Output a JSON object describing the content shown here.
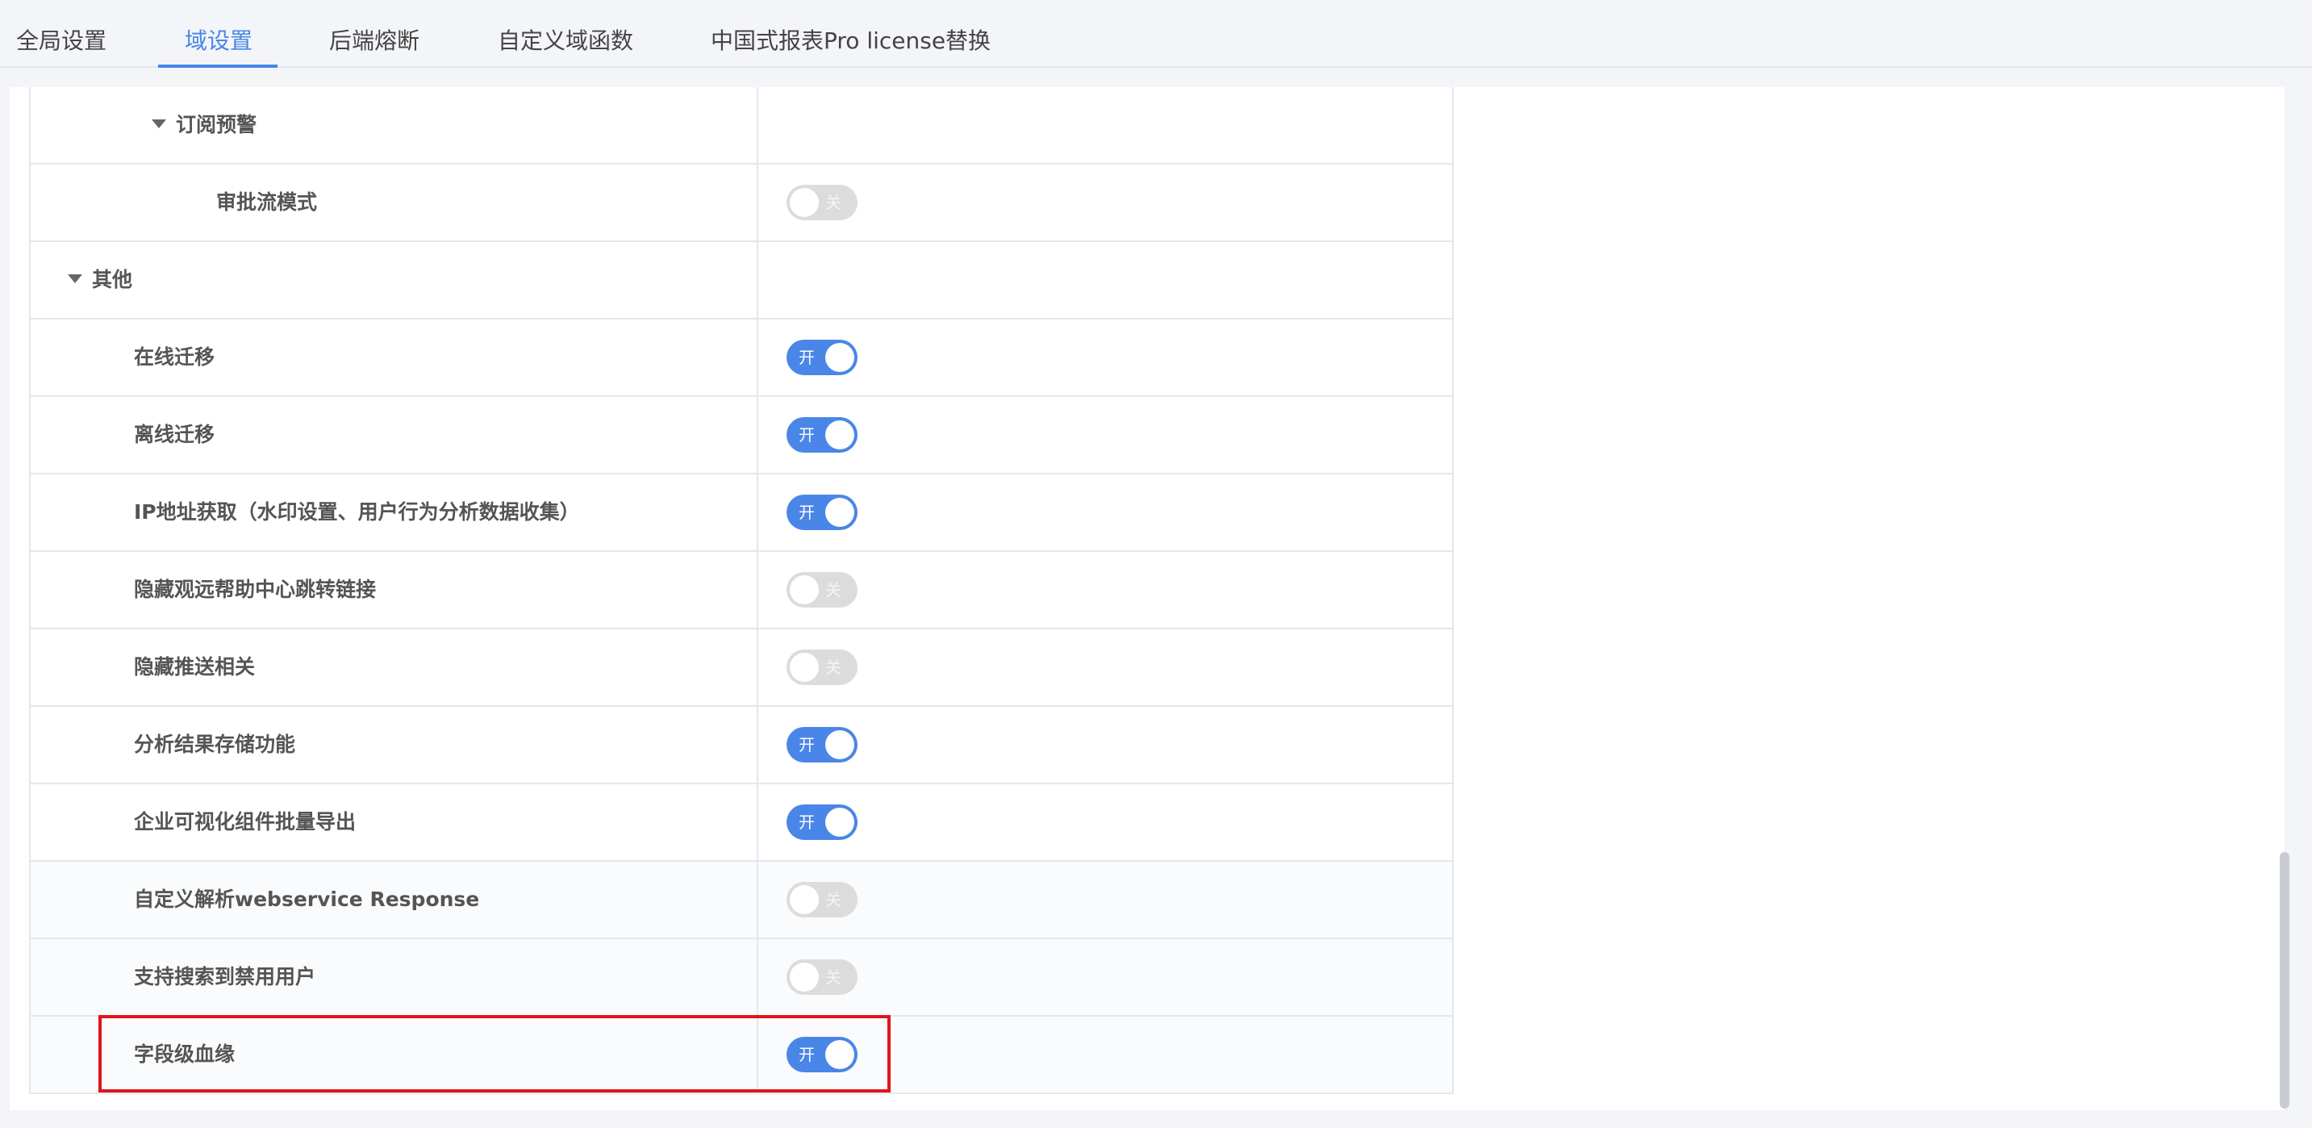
{
  "tabs": [
    {
      "label": "全局设置",
      "active": false
    },
    {
      "label": "域设置",
      "active": true
    },
    {
      "label": "后端熔断",
      "active": false
    },
    {
      "label": "自定义域函数",
      "active": false
    },
    {
      "label": "中国式报表Pro license替换",
      "active": false
    }
  ],
  "toggle_text": {
    "on": "开",
    "off": "关"
  },
  "rows": [
    {
      "label": "订阅预警",
      "type": "group",
      "expanded": true
    },
    {
      "label": "审批流模式",
      "type": "setting",
      "state": "off"
    },
    {
      "label": "其他",
      "type": "group",
      "expanded": true
    },
    {
      "label": "在线迁移",
      "type": "setting",
      "state": "on"
    },
    {
      "label": "离线迁移",
      "type": "setting",
      "state": "on"
    },
    {
      "label": "IP地址获取（水印设置、用户行为分析数据收集）",
      "type": "setting",
      "state": "on"
    },
    {
      "label": "隐藏观远帮助中心跳转链接",
      "type": "setting",
      "state": "off"
    },
    {
      "label": "隐藏推送相关",
      "type": "setting",
      "state": "off"
    },
    {
      "label": "分析结果存储功能",
      "type": "setting",
      "state": "on"
    },
    {
      "label": "企业可视化组件批量导出",
      "type": "setting",
      "state": "on"
    },
    {
      "label": "自定义解析webservice Response",
      "type": "setting",
      "state": "off"
    },
    {
      "label": "支持搜索到禁用用户",
      "type": "setting",
      "state": "off"
    },
    {
      "label": "字段级血缘",
      "type": "setting",
      "state": "on",
      "highlighted": true
    }
  ],
  "colors": {
    "accent": "#4a86e8",
    "toggle_off": "#dcdcdc",
    "highlight_border": "#e0151b"
  }
}
